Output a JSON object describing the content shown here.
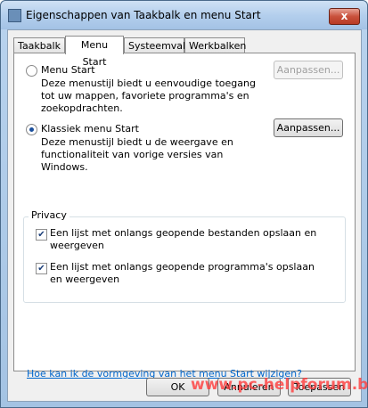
{
  "window": {
    "title": "Eigenschappen van Taakbalk en menu Start",
    "close_label": "x"
  },
  "tabs": [
    {
      "label": "Taakbalk",
      "active": false
    },
    {
      "label": "Menu Start",
      "active": true
    },
    {
      "label": "Systeemvak",
      "active": false
    },
    {
      "label": "Werkbalken",
      "active": false
    }
  ],
  "options": {
    "menu_start": {
      "label": "Menu Start",
      "checked": false,
      "description": "Deze menustijl biedt u eenvoudige toegang tot uw mappen, favoriete programma's en zoekopdrachten.",
      "button": "Aanpassen...",
      "button_enabled": false
    },
    "classic": {
      "label": "Klassiek menu Start",
      "checked": true,
      "description": "Deze menustijl biedt u de weergave en functionaliteit van vorige versies van Windows.",
      "button": "Aanpassen...",
      "button_enabled": true
    }
  },
  "privacy": {
    "label": "Privacy",
    "items": [
      {
        "label": "Een lijst met onlangs geopende bestanden opslaan en weergeven",
        "checked": true
      },
      {
        "label": "Een lijst met onlangs geopende programma's opslaan en weergeven",
        "checked": true
      }
    ]
  },
  "help_link": "Hoe kan ik de vormgeving van het menu Start wijzigen?",
  "footer": {
    "ok": "OK",
    "cancel": "Annuleren",
    "apply": "Toepassen"
  },
  "watermark": "www.pc-helpforum.be",
  "colors": {
    "title_gradient_top": "#cfe1f4",
    "link": "#0066cc",
    "watermark": "#ff3b3b"
  }
}
